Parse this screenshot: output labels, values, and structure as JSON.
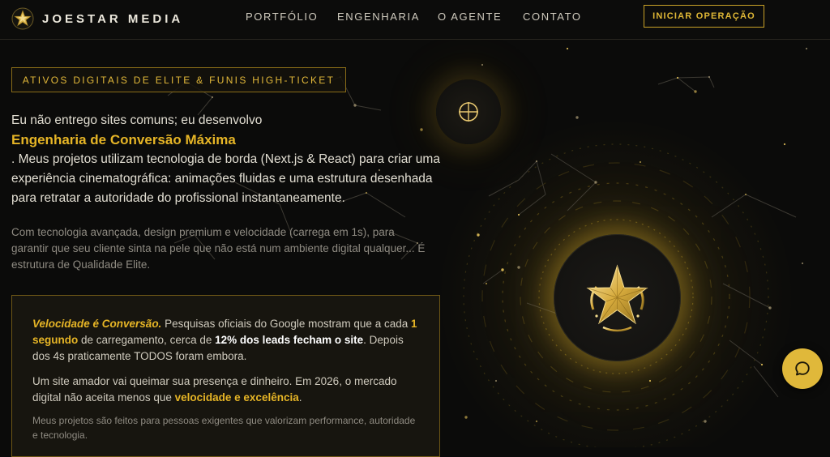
{
  "header": {
    "brand": "JOESTAR MEDIA",
    "brand_logo_icon": "star-emblem-icon",
    "nav": [
      "PORTFÓLIO",
      "ENGENHARIA",
      "O AGENTE",
      "CONTATO"
    ],
    "cta": "INICIAR OPERAÇÃO"
  },
  "hero": {
    "tag": "ATIVOS DIGITAIS DE ELITE & FUNIS HIGH-TICKET",
    "lead_line1": "Eu não entrego sites comuns; eu desenvolvo",
    "lead_highlight": "Engenharia de Conversão Máxima",
    "lead_rest": ". Meus projetos utilizam tecnologia de borda (Next.js & React) para criar uma experiência cinematográfica: animações fluidas e uma estrutura desenhada para retratar a autoridade do profissional instantaneamente.",
    "sub": "Com tecnologia avançada, design premium e velocidade (carrega em 1s), para garantir que seu cliente sinta na pele que não está num ambiente digital qualquer... É estrutura de Qualidade Elite."
  },
  "card": {
    "p1_a": "Velocidade é Conversão.",
    "p1_b": " Pesquisas oficiais do Google mostram que a cada ",
    "p1_c": "1 segundo",
    "p1_d": " de carregamento, cerca de ",
    "p1_e": "12% dos leads fecham o site",
    "p1_f": ". Depois dos 4s praticamente TODOS foram embora.",
    "p2_a": "Um site amador vai queimar sua presença e dinheiro. Em 2026, o mercado digital não aceita menos que ",
    "p2_b": "velocidade e excelência",
    "p2_c": ".",
    "p3": "Meus projetos são feitos para pessoas exigentes que valorizam performance, autoridade e tecnologia."
  },
  "icons": {
    "orb": "crosshair-icon",
    "emblem": "star-emblem-icon",
    "chat": "chat-bubble-icon"
  },
  "colors": {
    "background": "#0b0b0a",
    "gold": "#e6b526",
    "gold_border": "#c9a227",
    "text": "#d8d4c8",
    "muted": "#8f8b82"
  }
}
